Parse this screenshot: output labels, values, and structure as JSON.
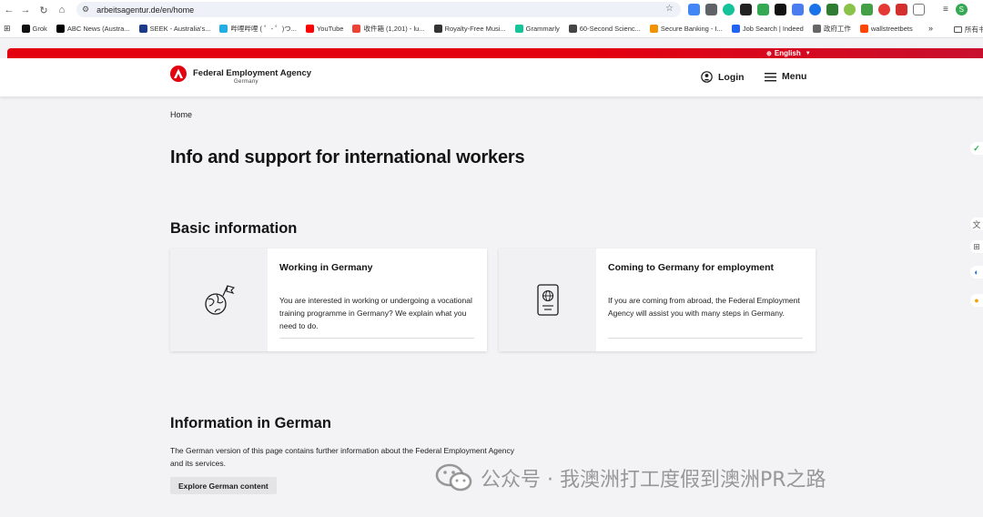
{
  "browser": {
    "url": "arbeitsagentur.de/en/home",
    "profile_initial": "S"
  },
  "bookmarks": [
    {
      "label": "Grok",
      "color": "#111111"
    },
    {
      "label": "ABC News (Austra...",
      "color": "#000000"
    },
    {
      "label": "SEEK - Australia's...",
      "color": "#1b3a8c"
    },
    {
      "label": "哔哩哔哩 ( ゜- ゜)つ...",
      "color": "#23ade5"
    },
    {
      "label": "YouTube",
      "color": "#ff0000"
    },
    {
      "label": "收件箱 (1,201) - lu...",
      "color": "#ea4335"
    },
    {
      "label": "Royalty-Free Musi...",
      "color": "#333333"
    },
    {
      "label": "Grammarly",
      "color": "#15c39a"
    },
    {
      "label": "60-Second Scienc...",
      "color": "#444444"
    },
    {
      "label": "Secure Banking - I...",
      "color": "#f39200"
    },
    {
      "label": "Job Search | Indeed",
      "color": "#2164f3"
    },
    {
      "label": "政府工作",
      "color": "#666666"
    },
    {
      "label": "wallstreetbets",
      "color": "#ff4500"
    }
  ],
  "bookmarks_overflow": "»",
  "bookmarks_all": "所有书",
  "header": {
    "language": "English",
    "agency_name": "Federal Employment Agency",
    "agency_sub": "Germany",
    "login_label": "Login",
    "menu_label": "Menu"
  },
  "breadcrumb": "Home",
  "page_title": "Info and support for international workers",
  "basic_info": {
    "title": "Basic information",
    "cards": [
      {
        "title": "Working in Germany",
        "description": "You are interested in working or undergoing a vocational training programme in Germany? We explain what you need to do.",
        "icon": "globe-flag-icon"
      },
      {
        "title": "Coming to Germany for employment",
        "description": "If you are coming from abroad, the Federal Employment Agency will assist you with many steps in Germany.",
        "icon": "passport-icon"
      }
    ]
  },
  "german_info": {
    "title": "Information in German",
    "description": "The German version of this page contains further information about the Federal Employment Agency and its services.",
    "button_label": "Explore German content"
  },
  "watermark": "公众号 · 我澳洲打工度假到澳洲PR之路",
  "colors": {
    "brand_red": "#e3000f",
    "background": "#f3f3f5",
    "button_grey": "#e4e4e7"
  }
}
